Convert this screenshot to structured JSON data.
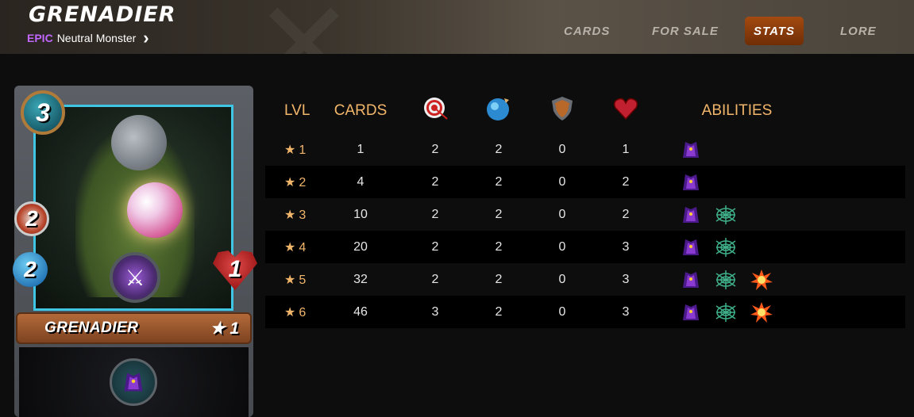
{
  "header": {
    "title": "GRENADIER",
    "rarity": "EPIC",
    "subtitle_rest": "Neutral Monster",
    "tabs": [
      "CARDS",
      "FOR SALE",
      "STATS",
      "LORE"
    ],
    "active_tab": "STATS"
  },
  "card": {
    "mana": "3",
    "ranged": "2",
    "magic": "2",
    "health": "1",
    "name": "GRENADIER",
    "level": "★ 1",
    "ability_icon": "shield-cloak-icon"
  },
  "table": {
    "headers": {
      "lvl": "LVL",
      "cards": "CARDS",
      "ranged_icon": "ranged-attack-icon",
      "magic_icon": "magic-attack-icon",
      "armor_icon": "armor-icon",
      "health_icon": "health-icon",
      "abilities": "ABILITIES"
    },
    "rows": [
      {
        "lvl": "1",
        "cards": "1",
        "ranged": "2",
        "magic": "2",
        "armor": "0",
        "health": "1",
        "abilities": [
          "cloak"
        ]
      },
      {
        "lvl": "2",
        "cards": "4",
        "ranged": "2",
        "magic": "2",
        "armor": "0",
        "health": "2",
        "abilities": [
          "cloak"
        ]
      },
      {
        "lvl": "3",
        "cards": "10",
        "ranged": "2",
        "magic": "2",
        "armor": "0",
        "health": "2",
        "abilities": [
          "cloak",
          "web"
        ]
      },
      {
        "lvl": "4",
        "cards": "20",
        "ranged": "2",
        "magic": "2",
        "armor": "0",
        "health": "3",
        "abilities": [
          "cloak",
          "web"
        ]
      },
      {
        "lvl": "5",
        "cards": "32",
        "ranged": "2",
        "magic": "2",
        "armor": "0",
        "health": "3",
        "abilities": [
          "cloak",
          "web",
          "blast"
        ]
      },
      {
        "lvl": "6",
        "cards": "46",
        "ranged": "3",
        "magic": "2",
        "armor": "0",
        "health": "3",
        "abilities": [
          "cloak",
          "web",
          "blast"
        ]
      }
    ]
  },
  "colors": {
    "accent": "#f2b66a",
    "rarity": "#c067ff",
    "active_tab": "#a34a10"
  }
}
